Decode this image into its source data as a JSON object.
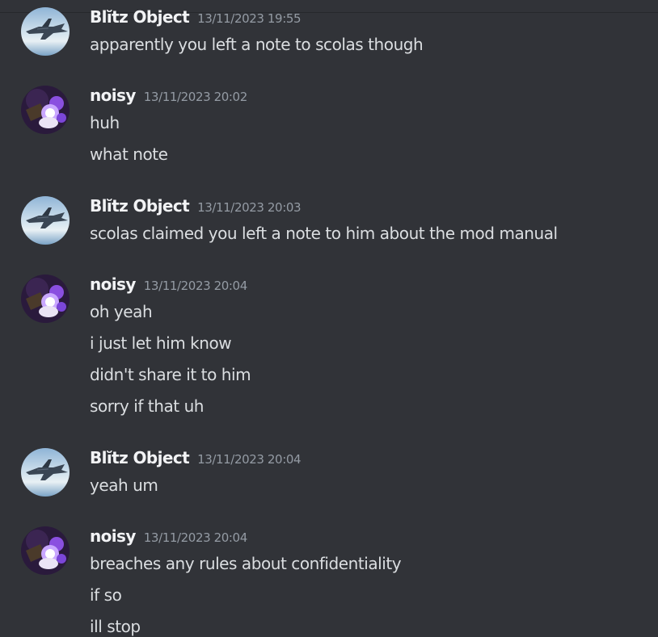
{
  "users": {
    "blitz": "Blĭtz Object",
    "noisy": "noisy"
  },
  "colors": {
    "background": "#313338",
    "username": "#f2f3f5",
    "timestamp": "#949ba4",
    "text": "#dbdee1"
  },
  "avatars": {
    "blitz": "fighter-jet-avatar",
    "noisy": "purple-character-avatar"
  },
  "messages": [
    {
      "author": "Blĭtz Object",
      "timestamp": "13/11/2023 19:55",
      "lines": [
        "apparently you left a note to scolas though"
      ]
    },
    {
      "author": "noisy",
      "timestamp": "13/11/2023 20:02",
      "lines": [
        "huh",
        "what note"
      ]
    },
    {
      "author": "Blĭtz Object",
      "timestamp": "13/11/2023 20:03",
      "lines": [
        "scolas claimed you left a note to him about the mod manual"
      ]
    },
    {
      "author": "noisy",
      "timestamp": "13/11/2023 20:04",
      "lines": [
        "oh yeah",
        "i just let him know",
        "didn't share it to him",
        "sorry if that uh"
      ]
    },
    {
      "author": "Blĭtz Object",
      "timestamp": "13/11/2023 20:04",
      "lines": [
        "yeah um"
      ]
    },
    {
      "author": "noisy",
      "timestamp": "13/11/2023 20:04",
      "lines": [
        "breaches any rules about confidentiality",
        "if so",
        "ill stop"
      ]
    }
  ]
}
